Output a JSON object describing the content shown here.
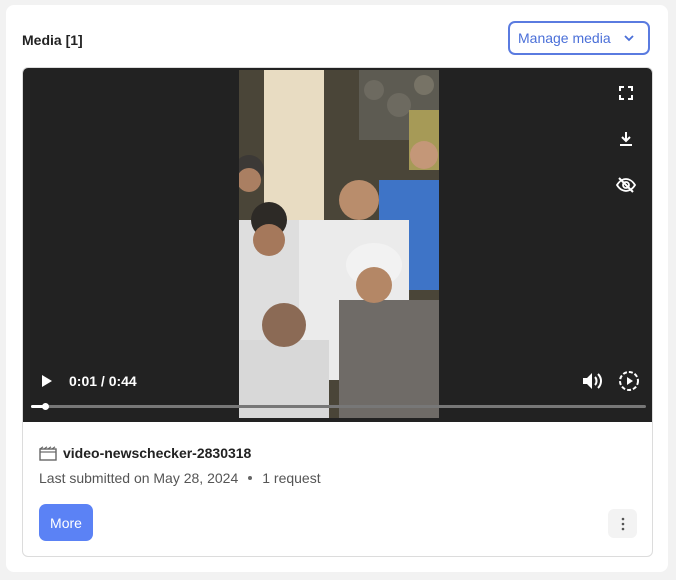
{
  "header": {
    "title": "Media [1]",
    "manage_label": "Manage media"
  },
  "video": {
    "time_display": "0:01 / 0:44",
    "progress": 0.023
  },
  "file": {
    "name": "video-newschecker-2830318",
    "submitted": "Last submitted on May 28, 2024",
    "requests": "1 request"
  },
  "actions": {
    "more_label": "More"
  },
  "colors": {
    "accent": "#5b82f5",
    "outline": "#5a7be0",
    "player_bg": "#222222"
  },
  "icons": [
    "chevron-down-icon",
    "fullscreen-icon",
    "download-icon",
    "hide-icon",
    "play-icon",
    "volume-icon",
    "playback-speed-icon",
    "video-file-icon",
    "more-vert-icon"
  ]
}
